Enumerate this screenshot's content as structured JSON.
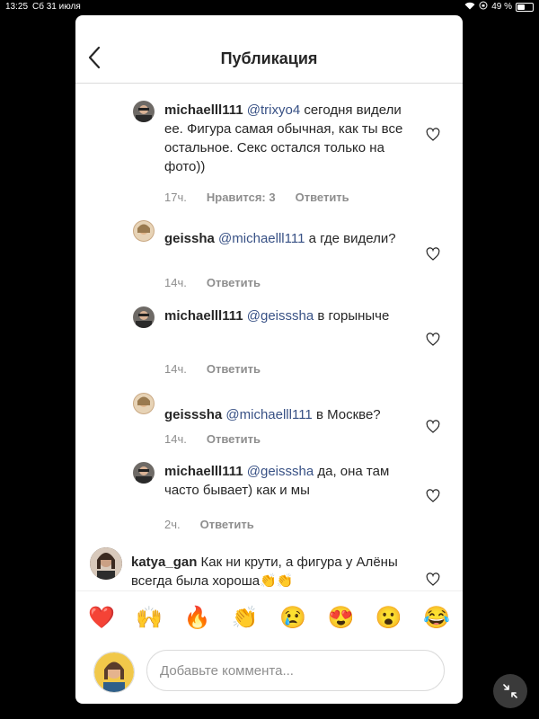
{
  "status_bar": {
    "time": "13:25",
    "date": "Сб 31 июля",
    "battery": "49 %"
  },
  "header": {
    "title": "Публикация"
  },
  "comments": [
    {
      "user": "michaelll111",
      "mention": "@trixyo4",
      "text": " сегодня видели ее. Фигура самая обычная, как ты все остальное. Секс остался только на фото))",
      "time": "17ч.",
      "likes": "Нравится: 3",
      "reply": "Ответить"
    },
    {
      "user": "geissha",
      "mention": "@michaelll111",
      "text": " а где видели?",
      "time": "14ч.",
      "reply": "Ответить"
    },
    {
      "user": "michaelll111",
      "mention": "@geisssha",
      "text": " в горыныче",
      "time": "14ч.",
      "reply": "Ответить"
    },
    {
      "user": "geisssha",
      "mention": "@michaelll111",
      "text": " в Москве?",
      "time": "14ч.",
      "reply": "Ответить"
    },
    {
      "user": "michaelll111",
      "mention": "@geisssha",
      "text": " да, она там часто бывает) как и мы",
      "time": "2ч.",
      "reply": "Ответить"
    },
    {
      "user": "katya_gan",
      "mention": "",
      "text": " Как ни крути, а фигура у Алёны всегда была хороша👏👏",
      "time": "",
      "reply": ""
    }
  ],
  "emoji_bar": [
    "❤️",
    "🙌",
    "🔥",
    "👏",
    "😢",
    "😍",
    "😮",
    "😂"
  ],
  "compose": {
    "placeholder": "Добавьте коммента..."
  },
  "colors": {
    "mention": "#385185",
    "meta": "#8e8e8e",
    "divider": "#dbdbdb"
  }
}
